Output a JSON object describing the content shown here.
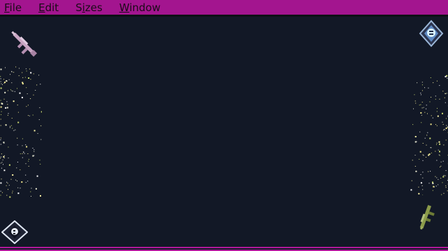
{
  "menubar": {
    "items": [
      {
        "accel": "F",
        "rest": "ile"
      },
      {
        "accel": "E",
        "rest": "dit"
      },
      {
        "pre": "S",
        "accel": "i",
        "rest": "zes"
      },
      {
        "accel": "W",
        "rest": "indow"
      }
    ]
  },
  "colors": {
    "background": "#121826",
    "menubar": "#a3158f",
    "menu_text": "#1a0a18",
    "accent_line": "#b0189a"
  },
  "icons": {
    "top_left": "rifle-icon",
    "top_right": "diamond-emblem-icon",
    "bottom_left": "diamond-emblem-icon",
    "bottom_right": "rifle-icon"
  }
}
